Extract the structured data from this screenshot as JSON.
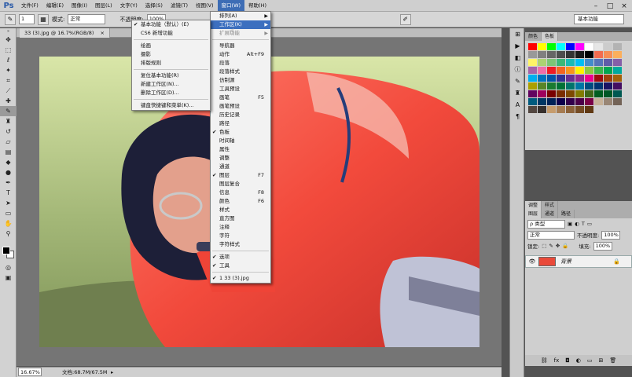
{
  "app": {
    "logo": "Ps"
  },
  "menubar": {
    "items": [
      "文件(F)",
      "编辑(E)",
      "图像(I)",
      "图层(L)",
      "文字(Y)",
      "选择(S)",
      "滤镜(T)",
      "视图(V)",
      "窗口(W)",
      "帮助(H)"
    ],
    "active_index": 8,
    "window_controls": [
      "–",
      "□",
      "×"
    ]
  },
  "options_bar": {
    "brush_size": "1",
    "mode_label": "模式:",
    "mode_value": "正常",
    "opacity_label": "不透明度:",
    "opacity_value": "100%",
    "workspace": "基本功能"
  },
  "document": {
    "tab_title": "33 (3).jpg @ 16.7%(RGB/8)",
    "zoom": "16.67%",
    "doc_info": "文档:68.7M/67.5M"
  },
  "window_menu": {
    "items": [
      {
        "label": "排列(A)",
        "arrow": true
      },
      {
        "label": "工作区(K)",
        "arrow": true,
        "highlighted": true
      },
      {
        "label": "扩展功能",
        "arrow": true,
        "disabled": true
      },
      {
        "sep": true
      },
      {
        "label": "导航器"
      },
      {
        "label": "动作",
        "shortcut": "Alt+F9"
      },
      {
        "label": "段落"
      },
      {
        "label": "段落样式"
      },
      {
        "label": "仿制源"
      },
      {
        "label": "工具预设"
      },
      {
        "label": "画笔",
        "shortcut": "F5"
      },
      {
        "label": "画笔预设"
      },
      {
        "label": "历史记录"
      },
      {
        "label": "路径"
      },
      {
        "label": "色板",
        "checked": true
      },
      {
        "label": "时间轴"
      },
      {
        "label": "属性"
      },
      {
        "label": "调整"
      },
      {
        "label": "通道"
      },
      {
        "label": "图层",
        "shortcut": "F7",
        "checked": true
      },
      {
        "label": "图层复合"
      },
      {
        "label": "信息",
        "shortcut": "F8"
      },
      {
        "label": "颜色",
        "shortcut": "F6"
      },
      {
        "label": "样式"
      },
      {
        "label": "直方图"
      },
      {
        "label": "注释"
      },
      {
        "label": "字符"
      },
      {
        "label": "字符样式"
      },
      {
        "sep": true
      },
      {
        "label": "选项",
        "checked": true
      },
      {
        "label": "工具",
        "checked": true
      },
      {
        "sep": true
      },
      {
        "label": "1 33 (3).jpg",
        "checked": true
      }
    ]
  },
  "workspace_menu": {
    "items": [
      {
        "label": "基本功能（默认）(E)",
        "checked": true
      },
      {
        "label": "CS6 新增功能"
      },
      {
        "sep": true
      },
      {
        "label": "绘画"
      },
      {
        "label": "摄影"
      },
      {
        "label": "排版规则"
      },
      {
        "sep": true
      },
      {
        "label": "复位基本功能(R)"
      },
      {
        "label": "新建工作区(N)..."
      },
      {
        "label": "删除工作区(D)..."
      },
      {
        "sep": true
      },
      {
        "label": "键盘快捷键和菜单(K)..."
      }
    ]
  },
  "panels": {
    "swatches_tabs": [
      "颜色",
      "色板"
    ],
    "adjust_tabs": [
      "调整",
      "样式"
    ],
    "layers_tabs": [
      "图层",
      "通道",
      "路径"
    ],
    "kind_label": "ρ 类型",
    "blend_mode": "正常",
    "opacity_label": "不透明度:",
    "opacity_value": "100%",
    "lock_label": "锁定:",
    "fill_label": "填充:",
    "fill_value": "100%",
    "layer_name": "背景"
  },
  "colors": {
    "accent": "#3d6db5",
    "swatches": [
      "#ff0000",
      "#ffff00",
      "#00ff00",
      "#00ffff",
      "#0000ff",
      "#ff00ff",
      "#ffffff",
      "#e6e6e6",
      "#cccccc",
      "#b3b3b3",
      "#999999",
      "#808080",
      "#666666",
      "#4d4d4d",
      "#333333",
      "#1a1a1a",
      "#000000",
      "#f26c4f",
      "#f68e56",
      "#fbaf5d",
      "#fff467",
      "#acd372",
      "#7cc576",
      "#3bb878",
      "#1abbb4",
      "#00bff3",
      "#438ccb",
      "#5574b9",
      "#605ca8",
      "#855fa8",
      "#a763a8",
      "#f06ea9",
      "#ed1c24",
      "#f26522",
      "#f7941d",
      "#fff200",
      "#8dc73f",
      "#39b54a",
      "#00a651",
      "#00a99d",
      "#00aeef",
      "#0072bc",
      "#0054a6",
      "#2e3192",
      "#662d91",
      "#92278f",
      "#ec008c",
      "#9e0b0f",
      "#a0410d",
      "#a3620a",
      "#aba000",
      "#598527",
      "#197b30",
      "#007236",
      "#00746b",
      "#0076a3",
      "#004b80",
      "#003471",
      "#1b1464",
      "#440e62",
      "#630460",
      "#9e005d",
      "#790000",
      "#7b2e00",
      "#7d4900",
      "#827b00",
      "#406618",
      "#005e20",
      "#005826",
      "#005952",
      "#005b7f",
      "#003663",
      "#002157",
      "#0d004c",
      "#32004b",
      "#4b0049",
      "#7b0046",
      "#c7b299",
      "#998675",
      "#736357",
      "#534741",
      "#37302d",
      "#c69c6d",
      "#a67c52",
      "#8c6239",
      "#754c24",
      "#603913"
    ]
  }
}
